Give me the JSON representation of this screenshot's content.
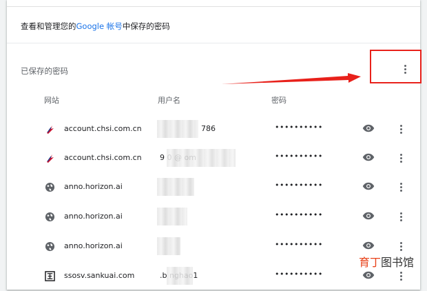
{
  "manage": {
    "prefix": "查看和管理您的",
    "link": "Google 帐号",
    "suffix": "中保存的密码"
  },
  "saved_passwords": {
    "title": "已保存的密码"
  },
  "columns": {
    "site": "网站",
    "username": "用户名",
    "password": "密码"
  },
  "rows": [
    {
      "site": "account.chsi.com.cn",
      "username": "786",
      "password": "••••••••••",
      "favicon": "chsi-logo-icon"
    },
    {
      "site": "account.chsi.com.cn",
      "username": "9 0 @ om",
      "password": "••••••••••",
      "favicon": "chsi-logo-icon"
    },
    {
      "site": "anno.horizon.ai",
      "username": "",
      "password": "••••••••••",
      "favicon": "globe-icon"
    },
    {
      "site": "anno.horizon.ai",
      "username": "",
      "password": "••••••••••",
      "favicon": "globe-icon"
    },
    {
      "site": "anno.horizon.ai",
      "username": "",
      "password": "••••••••••",
      "favicon": "globe-icon"
    },
    {
      "site": "ssosv.sankuai.com",
      "username": ".b nghao1",
      "password": "••••••••••",
      "favicon": "sankuai-logo-icon"
    }
  ],
  "colors": {
    "link": "#1a73e8",
    "annotation_red": "#e8211b",
    "icon_gray": "#5f6368"
  },
  "watermark": {
    "part_a": "育丁",
    "part_b": "图书馆"
  }
}
